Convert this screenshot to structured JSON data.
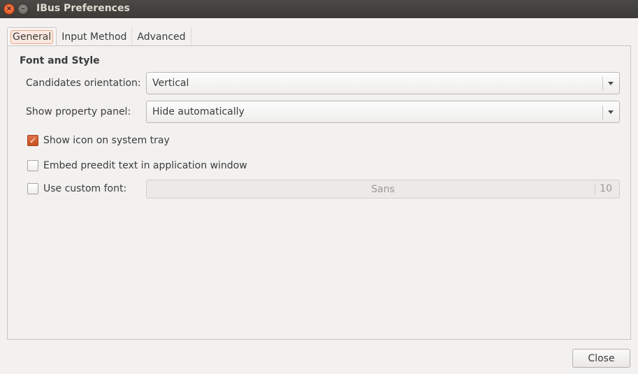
{
  "window": {
    "title": "IBus Preferences",
    "close_glyph": "×",
    "minimize_glyph": "–"
  },
  "tabs": [
    {
      "label": "General",
      "active": true
    },
    {
      "label": "Input Method",
      "active": false
    },
    {
      "label": "Advanced",
      "active": false
    }
  ],
  "general": {
    "section_title": "Font and Style",
    "candidates_orientation": {
      "label": "Candidates orientation:",
      "value": "Vertical"
    },
    "property_panel": {
      "label": "Show property panel:",
      "value": "Hide automatically"
    },
    "show_icon_tray": {
      "label": "Show icon on system tray",
      "checked": true
    },
    "embed_preedit": {
      "label": "Embed preedit text in application window",
      "checked": false
    },
    "custom_font": {
      "label": "Use custom font:",
      "checked": false,
      "font_name": "Sans",
      "font_size": "10"
    }
  },
  "footer": {
    "close_label": "Close"
  },
  "icons": {
    "check": "✓"
  },
  "colors": {
    "accent": "#dd4814",
    "titlebar": "#3c3b37",
    "background": "#f2f1f0"
  }
}
